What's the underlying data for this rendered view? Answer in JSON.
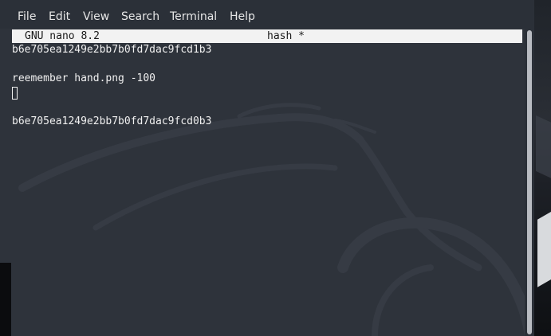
{
  "menubar": {
    "file": "File",
    "edit": "Edit",
    "view": "View",
    "search": "Search",
    "terminal": "Terminal",
    "help": "Help"
  },
  "nano": {
    "version": "GNU nano 8.2",
    "filename": "hash *"
  },
  "buffer": {
    "line1": "b6e705ea1249e2bb7b0fd7dac9fcd1b3",
    "line2": "reemember hand.png -100",
    "line4": "b6e705ea1249e2bb7b0fd7dac9fcd0b3"
  },
  "colors": {
    "terminal_bg": "#2e333b",
    "title_bar_bg": "#f2f2f2",
    "text": "#f0f0f0"
  }
}
